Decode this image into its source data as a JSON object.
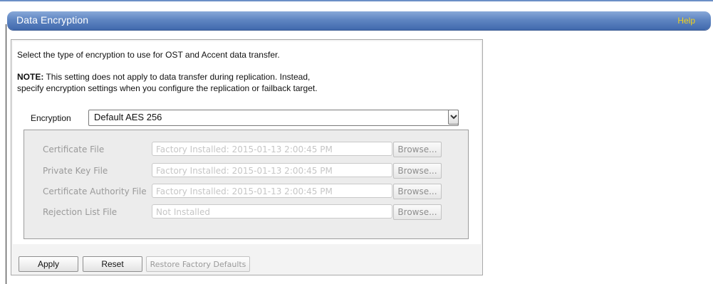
{
  "header": {
    "title": "Data Encryption",
    "help_label": "Help",
    "bar_color": "#4f77b8",
    "help_color": "#f2d21a"
  },
  "content": {
    "intro": "Select the type of encryption to use for OST and Accent data transfer.",
    "note_bold": "NOTE:",
    "note_text": " This setting does not apply to data transfer during replication. Instead,",
    "note_line2": "specify encryption settings when you configure the replication or failback target."
  },
  "encryption": {
    "label": "Encryption",
    "selected": "Default AES 256",
    "dropdown_icon": "chevron-down-icon"
  },
  "certificates": {
    "browse_label": "Browse...",
    "rows": [
      {
        "label": "Certificate File",
        "value": "Factory Installed: 2015-01-13 2:00:45 PM"
      },
      {
        "label": "Private Key File",
        "value": "Factory Installed: 2015-01-13 2:00:45 PM"
      },
      {
        "label": "Certificate Authority File",
        "value": "Factory Installed: 2015-01-13 2:00:45 PM"
      },
      {
        "label": "Rejection List File",
        "value": "Not Installed"
      }
    ]
  },
  "footer": {
    "apply_label": "Apply",
    "reset_label": "Reset",
    "restore_label": "Restore Factory Defaults"
  }
}
